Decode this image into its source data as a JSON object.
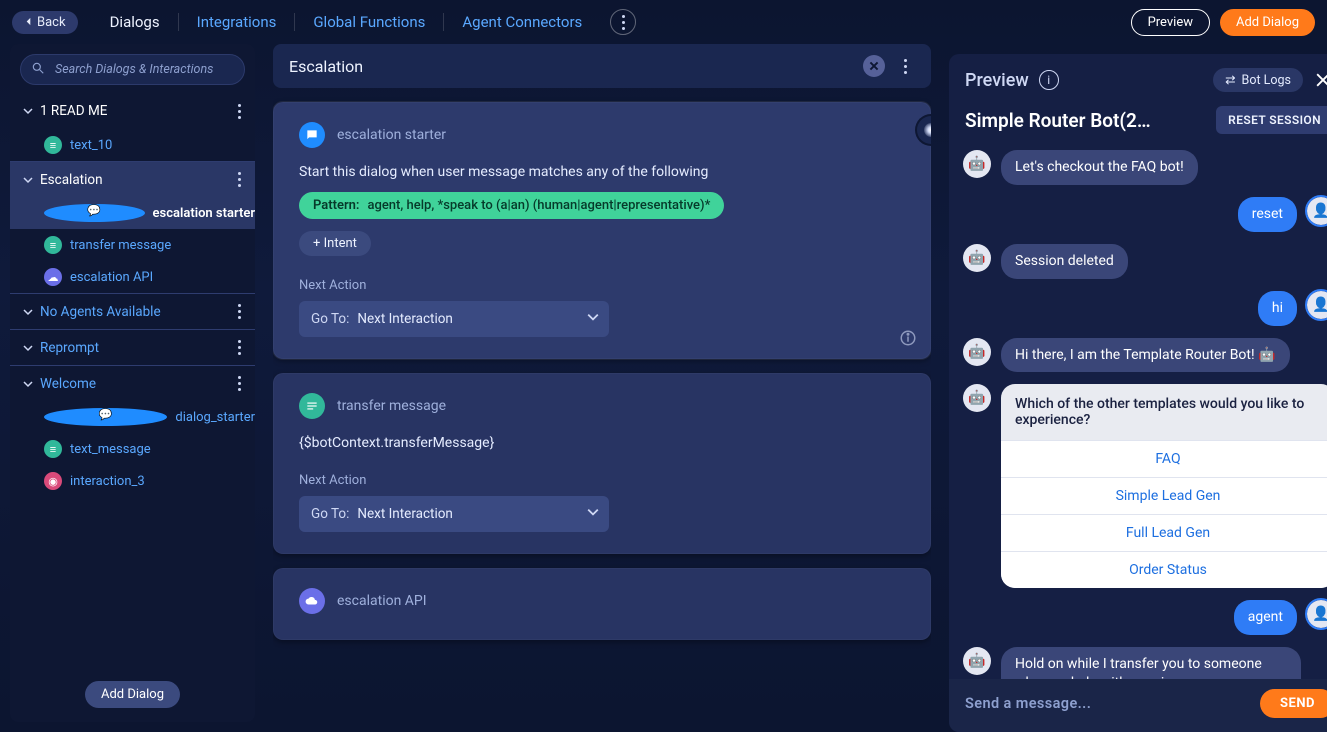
{
  "topbar": {
    "back": "Back",
    "tabs": [
      "Dialogs",
      "Integrations",
      "Global Functions",
      "Agent Connectors"
    ],
    "active_tab_index": 0,
    "preview": "Preview",
    "add_dialog": "Add Dialog"
  },
  "sidebar": {
    "search_placeholder": "Search Dialogs & Interactions",
    "add_dialog": "Add Dialog",
    "groups": [
      {
        "label": "1 READ ME",
        "expanded": true,
        "white": true,
        "items": [
          {
            "label": "text_10",
            "icon": "msg"
          }
        ]
      },
      {
        "label": "Escalation",
        "expanded": true,
        "selected": true,
        "white": true,
        "items": [
          {
            "label": "escalation starter",
            "icon": "chat",
            "selected": true,
            "bold": true
          },
          {
            "label": "transfer message",
            "icon": "msg"
          },
          {
            "label": "escalation API",
            "icon": "api"
          }
        ]
      },
      {
        "label": "No Agents Available",
        "expanded": false
      },
      {
        "label": "Reprompt",
        "expanded": false
      },
      {
        "label": "Welcome",
        "expanded": true,
        "items": [
          {
            "label": "dialog_starter",
            "icon": "chat"
          },
          {
            "label": "text_message",
            "icon": "msg"
          },
          {
            "label": "interaction_3",
            "icon": "record"
          }
        ]
      }
    ]
  },
  "center": {
    "header": "Escalation",
    "cards": [
      {
        "id": "escalation-starter",
        "icon": "blue",
        "title": "escalation starter",
        "desc": "Start this dialog when user message matches any of the following",
        "pattern_key": "Pattern:",
        "pattern_value": "agent, help, *speak to (a|an) (human|agent|representative)*",
        "intent": "+ Intent",
        "next_action_label": "Next Action",
        "goto_label": "Go To:",
        "goto_value": "Next Interaction",
        "show_info": true,
        "show_badge": true,
        "selected": true
      },
      {
        "id": "transfer-message",
        "icon": "green",
        "title": "transfer message",
        "code": "{$botContext.transferMessage}",
        "next_action_label": "Next Action",
        "goto_label": "Go To:",
        "goto_value": "Next Interaction"
      },
      {
        "id": "escalation-api",
        "icon": "purple",
        "title": "escalation API"
      }
    ]
  },
  "preview": {
    "title": "Preview",
    "bot_logs": "Bot Logs",
    "bot_name": "Simple Router Bot(2…",
    "reset": "RESET SESSION",
    "messages": [
      {
        "from": "bot",
        "text": "Let's checkout the FAQ bot!"
      },
      {
        "from": "user",
        "text": "reset"
      },
      {
        "from": "bot",
        "text": "Session deleted"
      },
      {
        "from": "user",
        "text": "hi"
      },
      {
        "from": "bot",
        "text": "Hi there, I am the Template Router Bot! 🤖"
      },
      {
        "from": "bot",
        "type": "card",
        "question": "Which of the other templates would you like to experience?",
        "options": [
          "FAQ",
          "Simple Lead Gen",
          "Full Lead Gen",
          "Order Status"
        ]
      },
      {
        "from": "user",
        "text": "agent"
      },
      {
        "from": "bot",
        "text": "Hold on while I transfer you to someone who can help with your issue..."
      }
    ],
    "compose_placeholder": "Send a message...",
    "send": "SEND"
  },
  "colors": {
    "accent": "#ff7a1a",
    "pattern_pill": "#40d39a",
    "link": "#5aa8ff"
  }
}
